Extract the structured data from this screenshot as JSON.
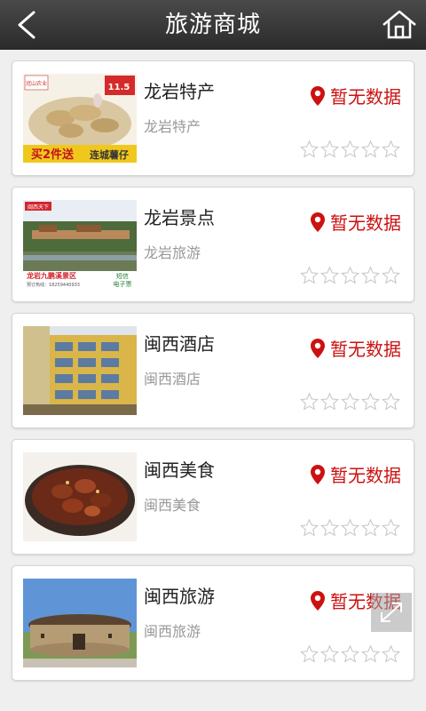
{
  "header": {
    "title": "旅游商城"
  },
  "items": [
    {
      "title": "龙岩特产",
      "subtitle": "龙岩特产",
      "status": "暂无数据",
      "rating": 0,
      "image_text": {
        "badge": "11.5",
        "promo": "买2件送",
        "brand": "连城薯仔",
        "logo": "冠山农业"
      }
    },
    {
      "title": "龙岩景点",
      "subtitle": "龙岩旅游",
      "status": "暂无数据",
      "rating": 0,
      "image_text": {
        "logo": "闽西天下",
        "scenic": "龙岩九鹏溪景区",
        "phone": "预订热线：18259440933",
        "ticket_1": "短信",
        "ticket_2": "电子票"
      }
    },
    {
      "title": "闽西酒店",
      "subtitle": "闽西酒店",
      "status": "暂无数据",
      "rating": 0
    },
    {
      "title": "闽西美食",
      "subtitle": "闽西美食",
      "status": "暂无数据",
      "rating": 0
    },
    {
      "title": "闽西旅游",
      "subtitle": "闽西旅游",
      "status": "暂无数据",
      "rating": 0
    }
  ],
  "colors": {
    "accent": "#cc1111",
    "header": "#333333"
  }
}
